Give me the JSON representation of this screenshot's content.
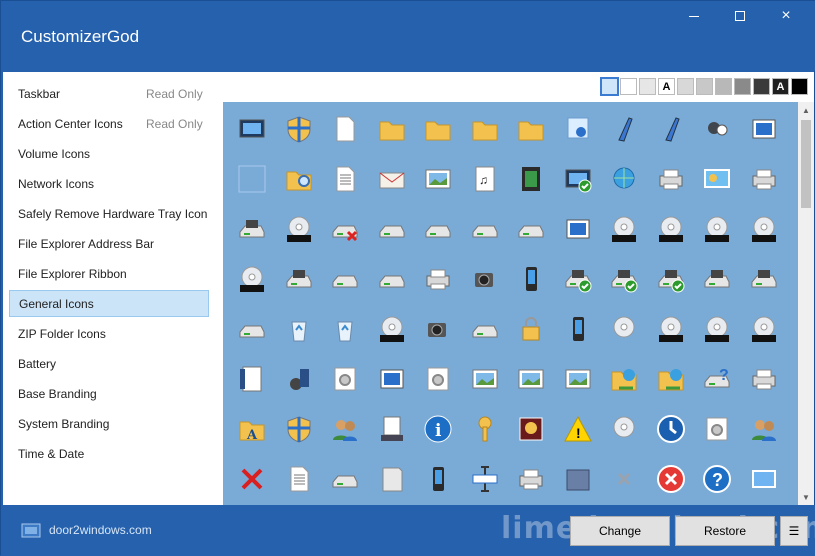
{
  "app": {
    "title": "CustomizerGod"
  },
  "window_buttons": {
    "minimize": "minimize",
    "maximize": "maximize",
    "close": "×"
  },
  "sidebar": {
    "items": [
      {
        "label": "Taskbar",
        "note": "Read Only"
      },
      {
        "label": "Action Center Icons",
        "note": "Read Only"
      },
      {
        "label": "Volume Icons",
        "note": ""
      },
      {
        "label": "Network Icons",
        "note": ""
      },
      {
        "label": "Safely Remove Hardware Tray Icon",
        "note": ""
      },
      {
        "label": "File Explorer Address Bar",
        "note": ""
      },
      {
        "label": "File Explorer Ribbon",
        "note": ""
      },
      {
        "label": "General Icons",
        "note": "",
        "selected": true
      },
      {
        "label": "ZIP Folder Icons",
        "note": ""
      },
      {
        "label": "Battery",
        "note": ""
      },
      {
        "label": "Base Branding",
        "note": ""
      },
      {
        "label": "System Branding",
        "note": ""
      },
      {
        "label": "Time & Date",
        "note": ""
      }
    ]
  },
  "swatches": [
    {
      "color": "#cfe6fa",
      "label": "",
      "selected": true
    },
    {
      "color": "#ffffff",
      "label": ""
    },
    {
      "color": "#e6e6e6",
      "label": ""
    },
    {
      "color": "#ffffff",
      "label": "A"
    },
    {
      "color": "#d8d8d8",
      "label": ""
    },
    {
      "color": "#c8c8c8",
      "label": ""
    },
    {
      "color": "#b8b8b8",
      "label": ""
    },
    {
      "color": "#8a8a8a",
      "label": ""
    },
    {
      "color": "#3a3a3a",
      "label": ""
    },
    {
      "color": "#202020",
      "label": "A"
    },
    {
      "color": "#000000",
      "label": ""
    }
  ],
  "icon_rows": [
    [
      "monitor-icon",
      "shield-flag-icon",
      "document-icon",
      "folder-icon",
      "folder-icon",
      "folder-icon",
      "folder-icon",
      "certificate-icon",
      "pen-icon",
      "pen-icon",
      "cards-icon",
      "window-icon"
    ],
    [
      "empty-icon",
      "folder-search-icon",
      "text-document-icon",
      "mail-icon",
      "picture-icon",
      "music-icon",
      "video-icon",
      "monitor-check-icon",
      "globe-icon",
      "printer-icon",
      "presentation-icon",
      "printer-icon"
    ],
    [
      "floppy-drive-icon",
      "cd-drive-icon",
      "drive-error-icon",
      "drive-icon",
      "network-drive-icon",
      "chip-icon",
      "drive-icon",
      "windows-drive-icon",
      "dvd-drive-icon",
      "dvd-r-icon",
      "dvd-ram-icon",
      "dvd-rom-icon"
    ],
    [
      "dvd-rw-icon",
      "floppy-drive-icon",
      "drive-icon",
      "server-icon",
      "network-printer-icon",
      "camcorder-icon",
      "phone-icon",
      "floppy-check-icon",
      "floppy-check-icon",
      "floppy-check-icon",
      "floppy-drive-icon",
      "floppy-drive-icon"
    ],
    [
      "drive-green-icon",
      "recycle-empty-icon",
      "recycle-full-icon",
      "dvd-icon",
      "camera-icon",
      "usb-drive-icon",
      "lock-icon",
      "mp3-player-icon",
      "cd-icon",
      "cd-r-icon",
      "cd-rom-icon",
      "cd-rw-icon"
    ],
    [
      "contact-icon",
      "media-player-icon",
      "settings-icon",
      "settings-window-icon",
      "gear-icon",
      "image-icon",
      "landscape-icon",
      "photo-icon",
      "network-folder-icon",
      "network-folder-icon",
      "help-drive-icon",
      "scanner-icon"
    ],
    [
      "font-folder-icon",
      "security-shield-icon",
      "users-icon",
      "checklist-icon",
      "info-icon",
      "key-icon",
      "flowers-icon",
      "warning-icon",
      "music-disc-icon",
      "sync-icon",
      "gear-doc-icon",
      "users-icon"
    ],
    [
      "error-x-icon",
      "document-lines-icon",
      "computer-icon",
      "file-cabinet-icon",
      "mobile-icon",
      "text-cursor-icon",
      "scanner-icon",
      "case-icon",
      "grey-x-icon",
      "error-circle-icon",
      "help-circle-icon",
      "window-arrow-icon"
    ]
  ],
  "footer": {
    "brand": "door2windows.com",
    "change_label": "Change",
    "restore_label": "Restore",
    "menu_label": "☰",
    "watermark": "limedownload.com"
  }
}
